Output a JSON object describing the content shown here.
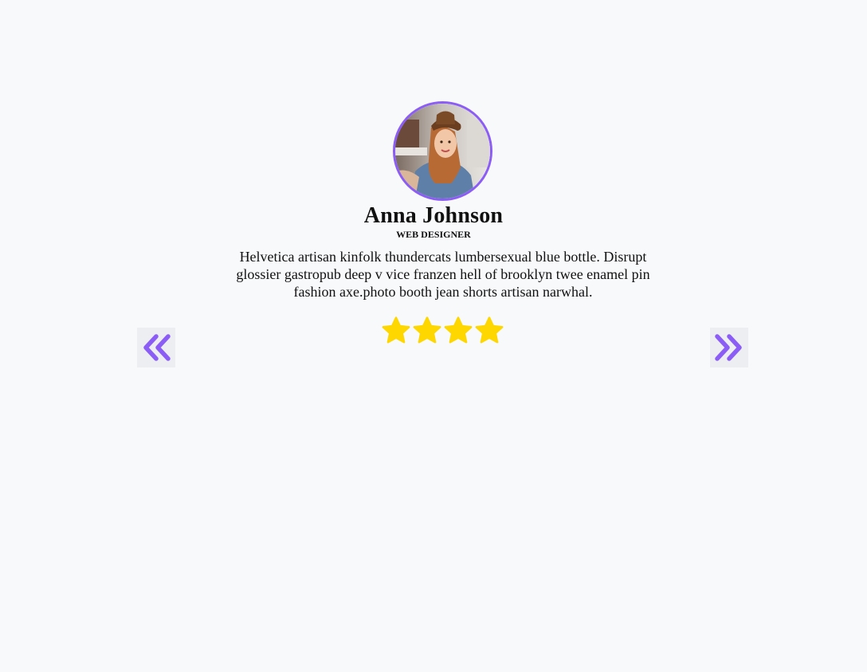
{
  "testimonial": {
    "name": "Anna Johnson",
    "role": "WEB DESIGNER",
    "quote": "Helvetica artisan kinfolk thundercats lumbersexual blue bottle. Disrupt glossier gastropub deep v vice franzen hell of brooklyn twee enamel pin fashion axe.photo booth jean shorts artisan narwhal.",
    "rating": 4,
    "rating_max": 4
  },
  "navigation": {
    "prev_icon": "chevrons-left-icon",
    "next_icon": "chevrons-right-icon"
  },
  "colors": {
    "accent": "#8b5cf6",
    "star": "#ffd700",
    "background": "#f8f9fb",
    "nav_bg": "#eceef2"
  }
}
